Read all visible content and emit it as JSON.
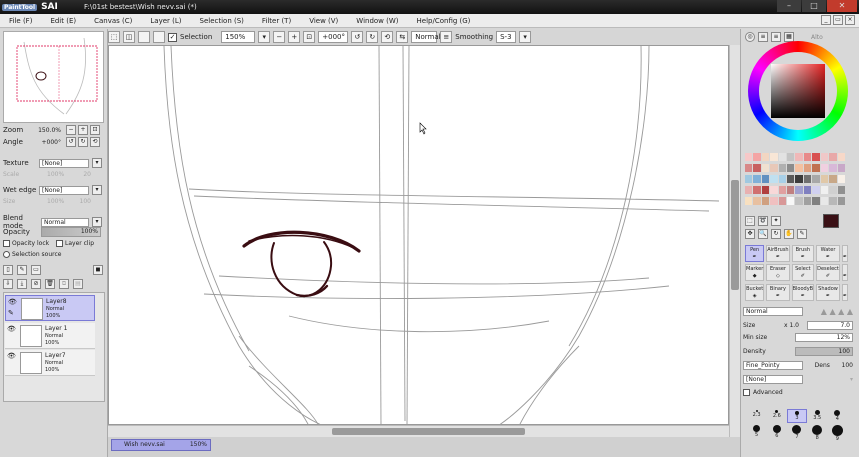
{
  "titlebar": {
    "app_name": "SAI",
    "app_prefix": "PaintTool",
    "path": "F:\\01st bestest\\Wish nevv.sai (*)"
  },
  "menu": [
    "File (F)",
    "Edit (E)",
    "Canvas (C)",
    "Layer (L)",
    "Selection (S)",
    "Filter (T)",
    "View (V)",
    "Window (W)",
    "Help/Config (G)"
  ],
  "toolbar": {
    "selection_label": "Selection",
    "zoom": "150%",
    "rotation": "+000°",
    "mode": "Normal",
    "smoothing_label": "Smoothing",
    "smoothing_value": "S-3"
  },
  "navigator": {
    "zoom_label": "Zoom",
    "zoom_value": "150.0%",
    "angle_label": "Angle",
    "angle_value": "+000°"
  },
  "layer_props": {
    "texture_label": "Texture",
    "texture_value": "[None]",
    "wetedge_label": "Wet edge",
    "wetedge_value": "[None]",
    "scale_label": "Scale",
    "scale_value": "100%",
    "scale_num": "20",
    "size_label": "Size",
    "size_value": "100%",
    "size_num": "100",
    "blend_label": "Blend mode",
    "blend_value": "Normal",
    "opacity_label": "Opacity",
    "opacity_value": "100%",
    "opacity_lock": "Opacity lock",
    "layer_clip": "Layer clip",
    "selection_source": "Selection source"
  },
  "layers": [
    {
      "name": "Layer8",
      "mode": "Normal",
      "opacity": "100%",
      "selected": true
    },
    {
      "name": "Layer 1",
      "mode": "Normal",
      "opacity": "100%",
      "selected": false
    },
    {
      "name": "Layer7",
      "mode": "Normal",
      "opacity": "100%",
      "selected": false
    }
  ],
  "document_tab": {
    "name": "Wish nevv.sai",
    "zoom": "150%"
  },
  "tools": [
    {
      "name": "Pen",
      "active": true
    },
    {
      "name": "AirBrush",
      "active": false
    },
    {
      "name": "Brush",
      "active": false
    },
    {
      "name": "Water",
      "active": false
    },
    {
      "name": "",
      "active": false
    },
    {
      "name": "Marker",
      "active": false
    },
    {
      "name": "Eraser",
      "active": false
    },
    {
      "name": "Select",
      "active": false
    },
    {
      "name": "Deselect",
      "active": false
    },
    {
      "name": "",
      "active": false
    },
    {
      "name": "Bucket",
      "active": false
    },
    {
      "name": "Binary",
      "active": false
    },
    {
      "name": "BloodyB",
      "active": false
    },
    {
      "name": "Shadow",
      "active": false
    },
    {
      "name": "",
      "active": false
    }
  ],
  "brush_props": {
    "mode": "Normal",
    "size_label": "Size",
    "size_mult": "x 1.0",
    "size_value": "7.0",
    "minsize_label": "Min size",
    "minsize_value": "12%",
    "density_label": "Density",
    "density_value": "100",
    "shape": "Fine_Pointy",
    "dens_label": "Dens",
    "dens_value": "100",
    "texture": "[None]",
    "advanced_label": "Advanced"
  },
  "brush_sizes": [
    "2.3",
    "2.6",
    "3",
    "3.5",
    "4",
    "5",
    "6",
    "7",
    "8",
    "9"
  ],
  "watermark": "Alto",
  "colors": {
    "selected_layer": "#c9c9f4",
    "stroke": "#3a0d12",
    "primary_color": "#3a1015"
  }
}
